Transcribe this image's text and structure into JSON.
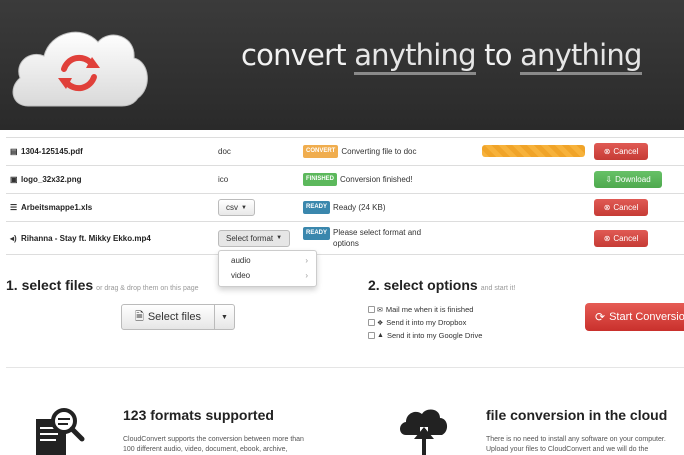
{
  "header": {
    "headline_1": "convert ",
    "headline_2": "anything",
    "headline_3": " to ",
    "headline_4": "anything",
    "logo_icon": "cloud-refresh-icon",
    "colors": {
      "background": "#2f2f2f",
      "logo_arrows": "#e0403a"
    }
  },
  "files": [
    {
      "icon": "pdf-file-icon",
      "name": "1304-125145.pdf",
      "format": "doc",
      "status_label": "CONVERT",
      "status_text": "Converting file to doc",
      "progress": 1.0,
      "action": "Cancel"
    },
    {
      "icon": "image-file-icon",
      "name": "logo_32x32.png",
      "format": "ico",
      "status_label": "FINISHED",
      "status_text": "Conversion finished!",
      "action": "Download"
    },
    {
      "icon": "spreadsheet-file-icon",
      "name": "Arbeitsmappe1.xls",
      "format": "csv",
      "status_label": "READY",
      "status_text": "Ready (24 KB)",
      "action": "Cancel"
    },
    {
      "icon": "audio-file-icon",
      "name": "Rihanna - Stay ft. Mikky Ekko.mp4",
      "format": "Select format",
      "status_label": "READY",
      "status_text_1": "Please select format and",
      "status_text_2": "options",
      "action": "Cancel"
    }
  ],
  "format_dropdown": {
    "items": [
      "audio",
      "video"
    ]
  },
  "select_files": {
    "title": "1. select files",
    "subtitle": "or drag & drop them on this page",
    "button": "Select files"
  },
  "select_options": {
    "title": "2. select options",
    "subtitle": "and start it!",
    "options": [
      {
        "label": "Mail me when it is finished",
        "icon": "mail-icon",
        "checked": false
      },
      {
        "label": "Send it into my Dropbox",
        "icon": "dropbox-icon",
        "checked": false
      },
      {
        "label": "Send it into my Google Drive",
        "icon": "google-drive-icon",
        "checked": false
      }
    ],
    "start_button": "Start Conversion"
  },
  "features": [
    {
      "icon": "document-search-icon",
      "title": "123 formats supported",
      "text_1": "CloudConvert supports the conversion between more than",
      "text_2": "100 different audio, video, document, ebook, archive,"
    },
    {
      "icon": "cloud-download-icon",
      "title": "file conversion in the cloud",
      "text_1": "There is no need to install any software on your computer.",
      "text_2": "Upload your files to CloudConvert and we will do the"
    }
  ]
}
